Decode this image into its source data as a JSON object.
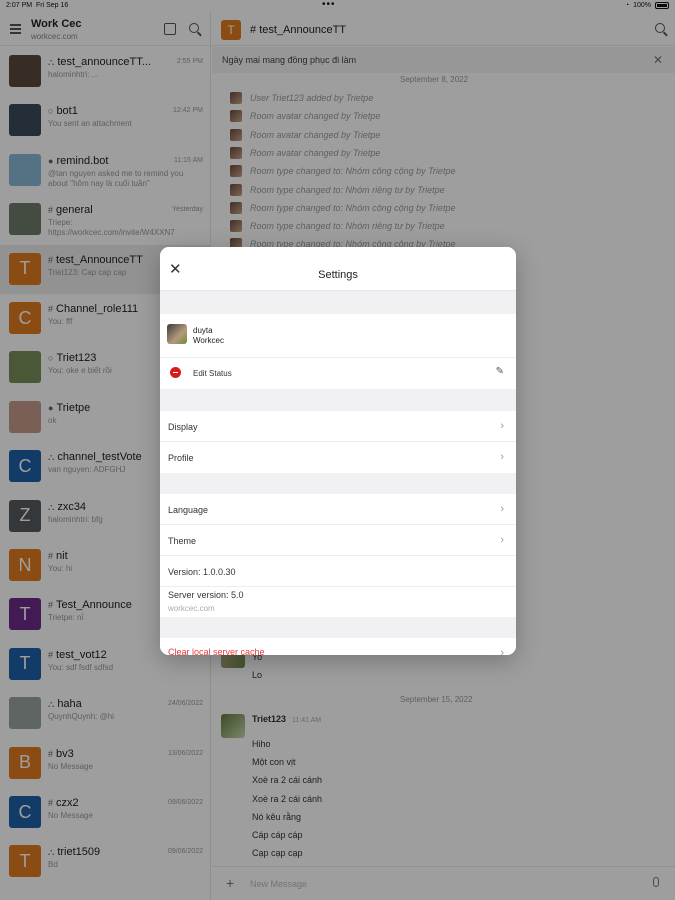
{
  "status_bar": {
    "time": "2:07 PM",
    "date": "Fri Sep 16",
    "battery": "100%"
  },
  "sidebar": {
    "workspace_name": "Work Cec",
    "workspace_host": "workcec.com",
    "rooms": [
      {
        "name": "test_announceTT...",
        "last": "halominhtri: ...",
        "time": "2:55 PM",
        "avatar_text": "",
        "avatar_color": "#5a4a3c",
        "prefix": "⛬"
      },
      {
        "name": "bot1",
        "last": "You sent an attachment",
        "time": "12:42 PM",
        "avatar_text": "",
        "avatar_color": "#3b4b5c",
        "prefix": "○"
      },
      {
        "name": "remind.bot",
        "last": "@tan nguyen asked me to remind you about \"hôm nay là cuối tuần\"",
        "time": "11:15 AM",
        "avatar_text": "",
        "avatar_color": "#8ab6d6",
        "prefix": "●"
      },
      {
        "name": "general",
        "last": "Triepe: https://workcec.com/invite/W4XXN7",
        "time": "Yesterday",
        "avatar_text": "",
        "avatar_color": "#6e7a6a",
        "prefix": "#"
      },
      {
        "name": "test_AnnounceTT",
        "last": "Triet123: Cap cap cap",
        "time": "",
        "avatar_text": "T",
        "avatar_color": "#e07b1f",
        "prefix": "#"
      },
      {
        "name": "Channel_role111",
        "last": "You: fff",
        "time": "",
        "avatar_text": "C",
        "avatar_color": "#e07b1f",
        "prefix": "#"
      },
      {
        "name": "Triet123",
        "last": "You: oke e biết rồi",
        "time": "",
        "avatar_text": "",
        "avatar_color": "#7a8f5a",
        "prefix": "○"
      },
      {
        "name": "Trietpe",
        "last": "ok",
        "time": "",
        "avatar_text": "",
        "avatar_color": "#c49a8a",
        "prefix": "●"
      },
      {
        "name": "channel_testVote",
        "last": "van nguyen: ADFGHJ",
        "time": "",
        "avatar_text": "C",
        "avatar_color": "#1f5fa8",
        "prefix": "⛬"
      },
      {
        "name": "zxc34",
        "last": "halominhtri: bfg",
        "time": "",
        "avatar_text": "Z",
        "avatar_color": "#555b60",
        "prefix": "⛬"
      },
      {
        "name": "nit",
        "last": "You: hi",
        "time": "",
        "avatar_text": "N",
        "avatar_color": "#e07b1f",
        "prefix": "#"
      },
      {
        "name": "Test_Announce",
        "last": "Trietpe: nỉ",
        "time": "",
        "avatar_text": "T",
        "avatar_color": "#6b2d8a",
        "prefix": "#"
      },
      {
        "name": "test_vot12",
        "last": "You: sdf fsdf sdfsd",
        "time": "",
        "avatar_text": "T",
        "avatar_color": "#1f5fa8",
        "prefix": "#"
      },
      {
        "name": "haha",
        "last": "QuynhQuynh: @hi",
        "time": "24/06/2022",
        "avatar_text": "",
        "avatar_color": "#9aa3a0",
        "prefix": "⛬"
      },
      {
        "name": "bv3",
        "last": "No Message",
        "time": "13/06/2022",
        "avatar_text": "B",
        "avatar_color": "#e07b1f",
        "prefix": "#"
      },
      {
        "name": "czx2",
        "last": "No Message",
        "time": "09/06/2022",
        "avatar_text": "C",
        "avatar_color": "#1f5fa8",
        "prefix": "#"
      },
      {
        "name": "triet1509",
        "last": "Bd",
        "time": "09/06/2022",
        "avatar_text": "T",
        "avatar_color": "#e07b1f",
        "prefix": "⛬"
      }
    ]
  },
  "chat": {
    "avatar_text": "T",
    "title": "test_AnnounceTT",
    "announcement": "Ngày mai mang đồng phục đi làm",
    "date_1": "September 8, 2022",
    "system_messages": [
      "User Triet123 added by Trietpe",
      "Room avatar changed by Trietpe",
      "Room avatar changed by Trietpe",
      "Room avatar changed by Trietpe",
      "Room type changed to: Nhóm công cộng by Trietpe",
      "Room type changed to: Nhóm riêng tư by Trietpe",
      "Room type changed to: Nhóm công cộng by Trietpe",
      "Room type changed to: Nhóm riêng tư by Trietpe",
      "Room type changed to: Nhóm công cộng by Trietpe"
    ],
    "early_msgs": [
      "Yo",
      "Lo"
    ],
    "date_2": "September 15, 2022",
    "author": "Triet123",
    "author_time": "11:41 AM",
    "messages": [
      "Hiho",
      "Một con vịt",
      "Xoè ra 2 cái cánh",
      "Xoè ra 2 cái cánh",
      "Nó kêu rằng",
      "Cáp cáp cáp",
      "Cạp cạp cạp"
    ],
    "composer_placeholder": "New Message"
  },
  "settings": {
    "title": "Settings",
    "user_name": "duyta",
    "user_server": "Workcec",
    "edit_status": "Edit Status",
    "display": "Display",
    "profile": "Profile",
    "language": "Language",
    "theme": "Theme",
    "version": "Version: 1.0.0.30",
    "server_version": "Server version: 5.0",
    "server_host": "workcec.com",
    "clear_cache": "Clear local server cache"
  }
}
